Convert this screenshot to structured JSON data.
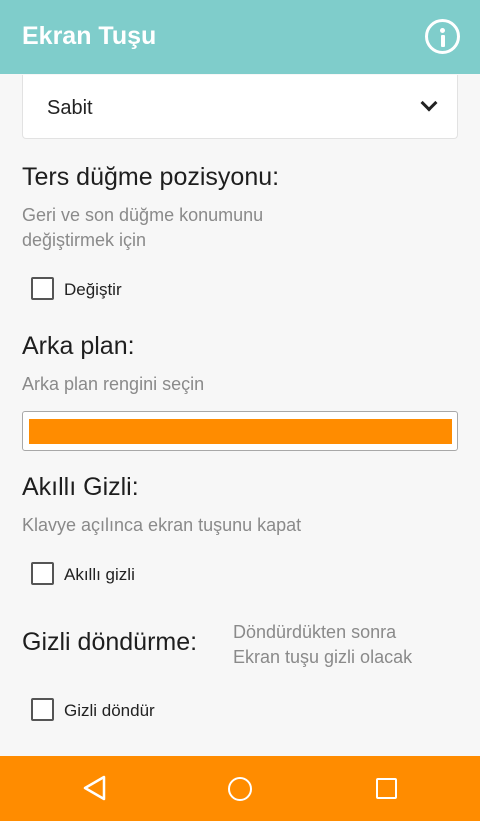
{
  "appbar": {
    "title": "Ekran Tuşu",
    "info_icon": "info-icon",
    "color": "#7fcdcb"
  },
  "position_select": {
    "value": "Sabit",
    "icon": "chevron-down-icon"
  },
  "reverse_buttons": {
    "heading": "Ters düğme pozisyonu:",
    "description_line1": "Geri ve son düğme konumunu",
    "description_line2": "değiştirmek için",
    "checkbox_label": "Değiştir",
    "checked": false
  },
  "background": {
    "heading": "Arka plan:",
    "description": "Arka plan rengini seçin",
    "selected_color": "#ff8c00"
  },
  "smart_hide": {
    "heading": "Akıllı Gizli:",
    "description": "Klavye açılınca ekran tuşunu kapat",
    "checkbox_label": "Akıllı gizli",
    "checked": false
  },
  "hide_rotate": {
    "heading": "Gizli döndürme:",
    "note_line1": "Döndürdükten sonra",
    "note_line2": "Ekran tuşu gizli olacak",
    "checkbox_label": "Gizli döndür",
    "checked": false
  },
  "navbar": {
    "color": "#ff8c00",
    "icons": [
      "back-icon",
      "home-icon",
      "recents-icon"
    ]
  }
}
